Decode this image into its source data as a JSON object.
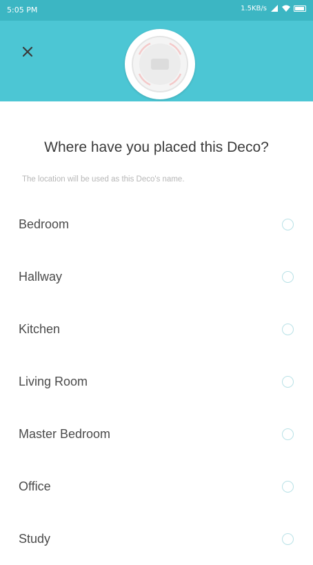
{
  "status_bar": {
    "time": "5:05 PM",
    "network_speed": "1.5KB/s",
    "icons": [
      "signal-icon",
      "wifi-icon",
      "battery-icon"
    ]
  },
  "header": {
    "close_icon": "close-icon",
    "device_image": "deco-device-image",
    "background_color": "#4cc6d4"
  },
  "main": {
    "title": "Where have you placed this Deco?",
    "subtitle": "The location will be used as this Deco's name.",
    "options": [
      {
        "label": "Bedroom",
        "selected": false
      },
      {
        "label": "Hallway",
        "selected": false
      },
      {
        "label": "Kitchen",
        "selected": false
      },
      {
        "label": "Living Room",
        "selected": false
      },
      {
        "label": "Master Bedroom",
        "selected": false
      },
      {
        "label": "Office",
        "selected": false
      },
      {
        "label": "Study",
        "selected": false
      }
    ]
  },
  "colors": {
    "accent": "#4cc6d4",
    "status_bar": "#3cb6c3",
    "radio_border": "#b7e1e6",
    "text_primary": "#3a3a3a",
    "text_secondary": "#b6b6b6"
  }
}
